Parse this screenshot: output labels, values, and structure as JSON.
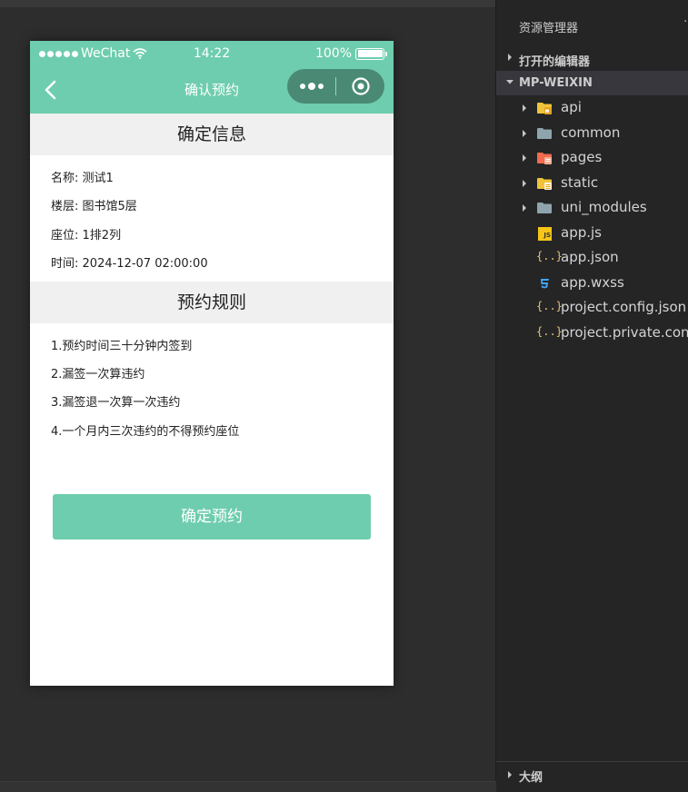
{
  "phone": {
    "status": {
      "carrier": "WeChat",
      "time": "14:22",
      "battery": "100%",
      "battery_level": 1.0
    },
    "navbar": {
      "title": "确认预约"
    },
    "info_section": {
      "title": "确定信息",
      "rows": [
        {
          "label": "名称:",
          "value": "测试1"
        },
        {
          "label": "楼层:",
          "value": "图书馆5层"
        },
        {
          "label": "座位:",
          "value": "1排2列"
        },
        {
          "label": "时间:",
          "value": "2024-12-07 02:00:00"
        }
      ]
    },
    "rules_section": {
      "title": "预约规则",
      "rules": [
        "1.预约时间三十分钟内签到",
        "2.漏签一次算违约",
        "3.漏签退一次算一次违约",
        "4.一个月内三次违约的不得预约座位"
      ]
    },
    "confirm_button": "确定预约",
    "colors": {
      "theme": "#6ecdae",
      "capsule": "#4a8a75",
      "section_bg": "#f0f0f0"
    }
  },
  "explorer": {
    "title": "资源管理器",
    "more": "···",
    "open_editors": "打开的编辑器",
    "project": "MP-WEIXIN",
    "items": [
      {
        "name": "api",
        "icon": "folder-api-icon",
        "folder": true
      },
      {
        "name": "common",
        "icon": "folder-icon",
        "folder": true
      },
      {
        "name": "pages",
        "icon": "folder-pages-icon",
        "folder": true
      },
      {
        "name": "static",
        "icon": "folder-static-icon",
        "folder": true
      },
      {
        "name": "uni_modules",
        "icon": "folder-icon",
        "folder": true
      },
      {
        "name": "app.js",
        "icon": "js-file-icon",
        "folder": false
      },
      {
        "name": "app.json",
        "icon": "json-file-icon",
        "folder": false
      },
      {
        "name": "app.wxss",
        "icon": "css-file-icon",
        "folder": false
      },
      {
        "name": "project.config.json",
        "icon": "json-file-icon",
        "folder": false
      },
      {
        "name": "project.private.config.json",
        "icon": "json-file-icon",
        "folder": false
      }
    ],
    "outline": "大纲",
    "icon_labels": {
      "js": "JS",
      "json": "{..}"
    }
  }
}
